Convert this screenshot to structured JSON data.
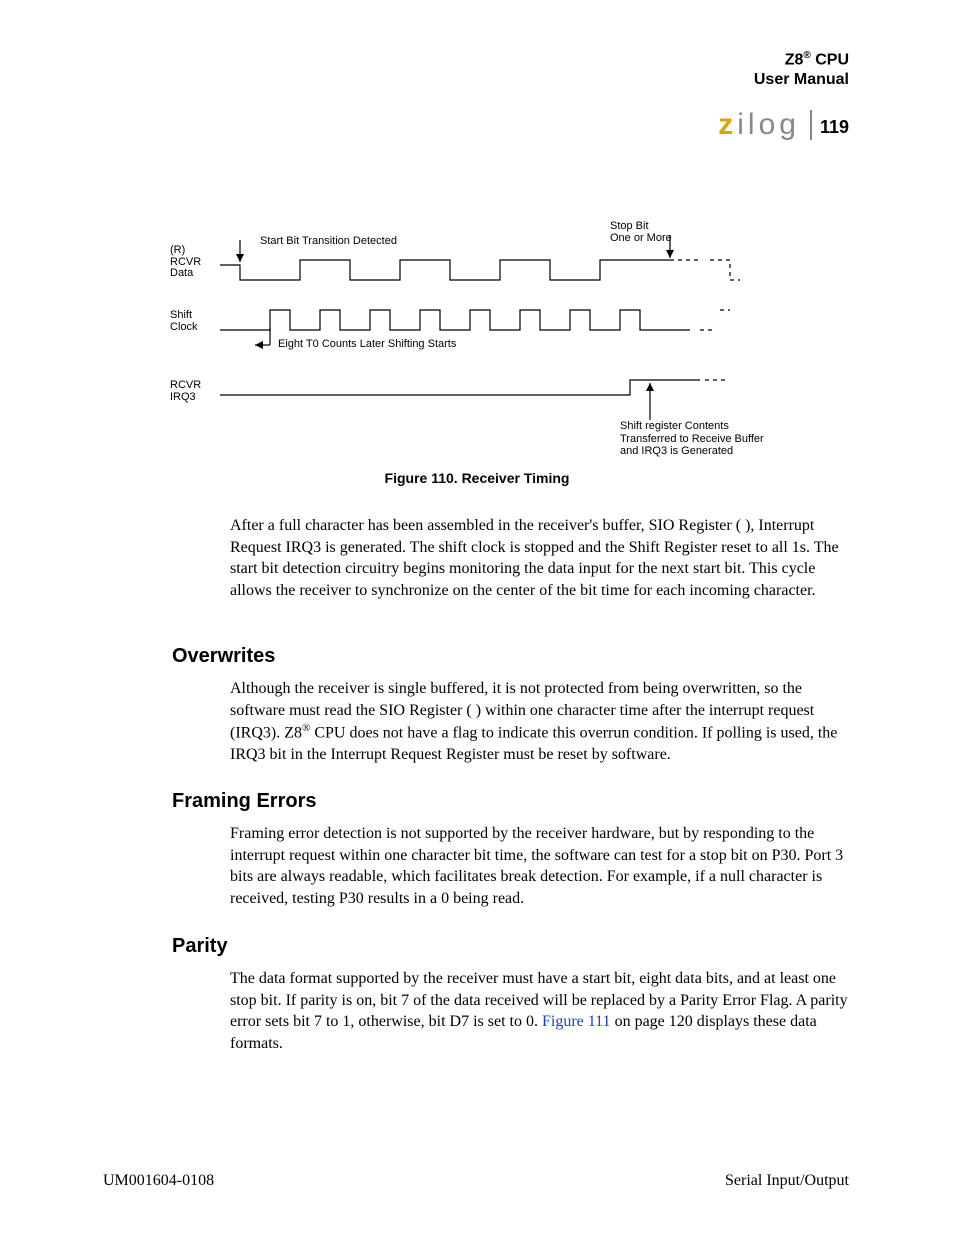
{
  "header": {
    "line1_a": "Z8",
    "line1_sup": "®",
    "line1_b": " CPU",
    "line2": "User Manual"
  },
  "logo": {
    "z": "z",
    "rest": "ilog"
  },
  "page_number": "119",
  "figure": {
    "labels": {
      "rcvr_data_r": "(R)",
      "rcvr_data": "RCVR",
      "rcvr_data2": "Data",
      "shift_clock1": "Shift",
      "shift_clock2": "Clock",
      "rcvr_irq1": "RCVR",
      "rcvr_irq2": "IRQ3",
      "start_bit": "Start Bit Transition Detected",
      "eight_t0": "Eight T0 Counts Later Shifting Starts",
      "stop_bit1": "Stop Bit",
      "stop_bit2": "One or More",
      "shift_reg1": "Shift register Contents",
      "shift_reg2": "Transferred to Receive Buffer",
      "shift_reg3": "and IRQ3 is Generated"
    },
    "caption": "Figure 110. Receiver Timing"
  },
  "para_after_figure": "After a full character has been assembled in the receiver's buffer, SIO Register (        ), Interrupt Request IRQ3 is generated. The shift clock is stopped and the Shift Register reset to all 1s. The start bit detection circuitry begins monitoring the data input for the next start bit. This cycle allows the receiver to synchronize on the center of the bit time for each incoming character.",
  "sections": {
    "overwrites": {
      "heading": "Overwrites",
      "body_a": "Although the receiver is single buffered, it is not protected from being overwritten, so the software must read the SIO Register (        ) within one character time after the interrupt request (IRQ3). Z8",
      "body_sup": "®",
      "body_b": " CPU does not have a flag to indicate this overrun condition. If polling is used, the IRQ3 bit in the Interrupt Request Register must be reset by software."
    },
    "framing": {
      "heading": "Framing Errors",
      "body": "Framing error detection is not supported by the receiver hardware, but by responding to the interrupt request within one character bit time, the software can test for a stop bit on P30. Port 3 bits are always readable, which facilitates break detection. For example, if a null character is received, testing P30 results in a 0 being read."
    },
    "parity": {
      "heading": "Parity",
      "body_a": "The data format supported by the receiver must have a start bit, eight data bits, and at least one stop bit. If parity is on, bit 7 of the data received will be replaced by a Parity Error Flag. A parity error sets bit 7 to 1, otherwise, bit D7 is set to 0. ",
      "link": "Figure 111",
      "body_b": " on page 120 displays these data formats."
    }
  },
  "footer": {
    "left": "UM001604-0108",
    "right": "Serial Input/Output"
  }
}
